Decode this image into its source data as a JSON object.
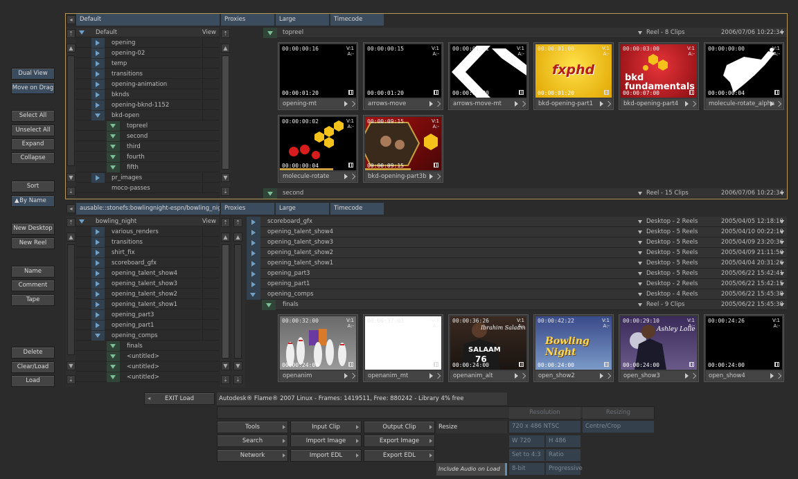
{
  "left_buttons": {
    "dual_view": "Dual View",
    "move_on_drag": "Move on Drag",
    "select_all": "Select All",
    "unselect_all": "Unselect All",
    "expand": "Expand",
    "collapse": "Collapse",
    "sort": "Sort",
    "by_name": "By Name",
    "new_desktop": "New Desktop",
    "new_reel": "New Reel",
    "name": "Name",
    "comment": "Comment",
    "tape": "Tape",
    "delete": "Delete",
    "clear_load": "Clear/Load",
    "load": "Load"
  },
  "top_panel": {
    "path": "Default",
    "tabs": [
      "Proxies",
      "Large",
      "Timecode"
    ],
    "tree_root": "Default",
    "view_label": "View",
    "tree": [
      {
        "label": "opening",
        "level": 1,
        "state": "closed"
      },
      {
        "label": "opening-02",
        "level": 1,
        "state": "closed"
      },
      {
        "label": "temp",
        "level": 1,
        "state": "closed"
      },
      {
        "label": "transitions",
        "level": 1,
        "state": "closed"
      },
      {
        "label": "opening-animation",
        "level": 1,
        "state": "closed"
      },
      {
        "label": "bknds",
        "level": 1,
        "state": "closed"
      },
      {
        "label": "opening-bknd-1152",
        "level": 1,
        "state": "closed"
      },
      {
        "label": "bkd-open",
        "level": 1,
        "state": "open"
      },
      {
        "label": "topreel",
        "level": 2,
        "state": "reel"
      },
      {
        "label": "second",
        "level": 2,
        "state": "reel"
      },
      {
        "label": "third",
        "level": 2,
        "state": "reel"
      },
      {
        "label": "fourth",
        "level": 2,
        "state": "reel"
      },
      {
        "label": "fifth",
        "level": 2,
        "state": "reel"
      },
      {
        "label": "pr_images",
        "level": 1,
        "state": "closed"
      },
      {
        "label": "moco-passes",
        "level": 1,
        "state": "none"
      }
    ],
    "reel1": {
      "name": "topreel",
      "info": "Reel - 8 Clips",
      "date": "2006/07/06 10:22:34"
    },
    "reel2": {
      "name": "second",
      "info": "Reel - 15 Clips",
      "date": "2006/07/06 10:22:34"
    },
    "clips": [
      {
        "name": "opening-mt",
        "tc_in": "00:00:00:16",
        "tc_out": "00:00:01:20",
        "v": "V:1",
        "a": "A:-",
        "thumb": "black"
      },
      {
        "name": "arrows-move",
        "tc_in": "00:00:00:15",
        "tc_out": "00:00:01:20",
        "v": "V:1",
        "a": "A:-",
        "thumb": "black"
      },
      {
        "name": "arrows-move-mt",
        "tc_in": "00:00:01:01",
        "tc_out": "00:00:01:20",
        "v": "V:1",
        "a": "A:-",
        "thumb": "arrows"
      },
      {
        "name": "bkd-opening-part1",
        "tc_in": "00:00:01:00",
        "tc_out": "00:00:01:20",
        "v": "V:1",
        "a": "A:-",
        "thumb": "fxphd",
        "logo": "fxphd"
      },
      {
        "name": "bkd-opening-part4",
        "tc_in": "00:00:03:00",
        "tc_out": "00:00:07:00",
        "v": "V:1",
        "a": "A:-",
        "thumb": "fund",
        "logo": "bkd fundamentals"
      },
      {
        "name": "molecule-rotate_alpha",
        "tc_in": "00:00:00:00",
        "tc_out": "00:00:00:04",
        "v": "V:1",
        "a": "A:-",
        "thumb": "alpha"
      },
      {
        "name": "molecule-rotate",
        "tc_in": "00:00:00:02",
        "tc_out": "00:00:00:04",
        "v": "V:1",
        "a": "A:-",
        "thumb": "molecule",
        "progress": 0.7
      },
      {
        "name": "bkd-opening-part3b",
        "tc_in": "00:00:09:15",
        "tc_out": "00:00:09:15",
        "v": "V:1",
        "a": "A:-",
        "thumb": "band",
        "progress": 0.6
      }
    ]
  },
  "bottom_panel": {
    "path": "ausable::stonefs:bowlingnight-espn/bowling_night",
    "tabs": [
      "Proxies",
      "Large",
      "Timecode"
    ],
    "tree_root": "bowling_night",
    "view_label": "View",
    "tree": [
      {
        "label": "various_renders",
        "level": 1,
        "state": "closed"
      },
      {
        "label": "transitions",
        "level": 1,
        "state": "closed"
      },
      {
        "label": "shirt_fix",
        "level": 1,
        "state": "closed"
      },
      {
        "label": "scoreboard_gfx",
        "level": 1,
        "state": "closed"
      },
      {
        "label": "opening_talent_show4",
        "level": 1,
        "state": "closed"
      },
      {
        "label": "opening_talent_show3",
        "level": 1,
        "state": "closed"
      },
      {
        "label": "opening_talent_show2",
        "level": 1,
        "state": "closed"
      },
      {
        "label": "opening_talent_show1",
        "level": 1,
        "state": "closed"
      },
      {
        "label": "opening_part3",
        "level": 1,
        "state": "closed"
      },
      {
        "label": "opening_part1",
        "level": 1,
        "state": "closed"
      },
      {
        "label": "opening_comps",
        "level": 1,
        "state": "open"
      },
      {
        "label": "finals",
        "level": 2,
        "state": "reel"
      },
      {
        "label": "<untitled>",
        "level": 2,
        "state": "reel"
      },
      {
        "label": "<untitled>",
        "level": 2,
        "state": "reel"
      },
      {
        "label": "<untitled>",
        "level": 2,
        "state": "reel"
      }
    ],
    "desktops": [
      {
        "name": "scoreboard_gfx",
        "info": "Desktop - 2 Reels",
        "date": "2005/04/05 12:18:10"
      },
      {
        "name": "opening_talent_show4",
        "info": "Desktop - 5 Reels",
        "date": "2005/04/10 00:22:10"
      },
      {
        "name": "opening_talent_show3",
        "info": "Desktop - 5 Reels",
        "date": "2005/04/09 23:20:36"
      },
      {
        "name": "opening_talent_show2",
        "info": "Desktop - 5 Reels",
        "date": "2005/04/09 21:11:50"
      },
      {
        "name": "opening_talent_show1",
        "info": "Desktop - 5 Reels",
        "date": "2005/04/04 20:31:26"
      },
      {
        "name": "opening_part3",
        "info": "Desktop - 5 Reels",
        "date": "2005/06/22 15:42:41"
      },
      {
        "name": "opening_part1",
        "info": "Desktop - 2 Reels",
        "date": "2005/06/22 15:42:15"
      },
      {
        "name": "opening_comps",
        "info": "Desktop - 4 Reels",
        "date": "2005/06/22 15:45:38"
      }
    ],
    "finals_reel": {
      "name": "finals",
      "info": "Reel - 9 Clips",
      "date": "2005/06/22 15:45:38"
    },
    "clips": [
      {
        "name": "openanim",
        "tc_in": "00:00:32:00",
        "tc_out": "00:00:24:00",
        "v": "V:1",
        "a": "A:-",
        "thumb": "pins"
      },
      {
        "name": "openanim_mt",
        "tc_in": "00:00:37:03",
        "tc_out": "00:00:24:00",
        "v": "V:1",
        "a": "A:-",
        "thumb": "white"
      },
      {
        "name": "openanim_alt",
        "tc_in": "00:00:36:26",
        "tc_out": "00:00:24:00",
        "v": "V:1",
        "a": "A:-",
        "thumb": "salaam",
        "logo": "SALAAM",
        "logo_num": "76",
        "caption": "Ibrahim Salaam"
      },
      {
        "name": "open_show2",
        "tc_in": "00:00:42:22",
        "tc_out": "00:00:24:00",
        "v": "V:1",
        "a": "A:-",
        "thumb": "bowlnight",
        "logo": "Bowling Night"
      },
      {
        "name": "open_show3",
        "tc_in": "00:00:29:10",
        "tc_out": "00:00:24:00",
        "v": "V:1",
        "a": "A:-",
        "thumb": "ashley",
        "caption": "Ashley Lolie"
      },
      {
        "name": "open_show4",
        "tc_in": "00:00:24:26",
        "tc_out": "00:00:24:00",
        "v": "V:1",
        "a": "A:-",
        "thumb": "black"
      }
    ]
  },
  "bottom_bar": {
    "exit_load": "EXIT Load",
    "status": "Autodesk® Flame® 2007 Linux - Frames: 1419511, Free: 880242 - Library 4% free",
    "tools": "Tools",
    "search": "Search",
    "network": "Network",
    "input_clip": "Input Clip",
    "import_image": "Import Image",
    "import_edl": "Import EDL",
    "output_clip": "Output Clip",
    "export_image": "Export Image",
    "export_edl": "Export EDL",
    "resize": "Resize",
    "include_audio": "Include Audio on Load",
    "resolution_header": "Resolution",
    "resizing_header": "Resizing",
    "resolution": "720 x 486 NTSC",
    "resizing_mode": "Centre/Crop",
    "width": "W 720",
    "height": "H 486",
    "set_to": "Set to 4:3",
    "ratio": "Ratio 1.333",
    "bit_depth": "8-bit",
    "scan": "Progressive"
  }
}
